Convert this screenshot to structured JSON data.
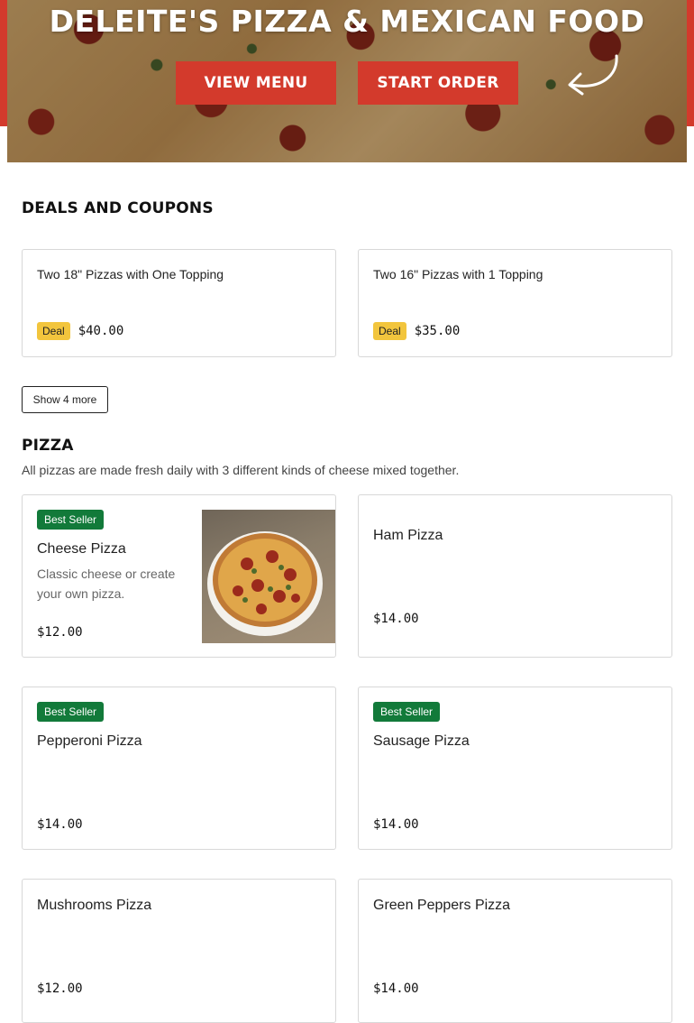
{
  "hero": {
    "title": "DELEITE'S PIZZA & MEXICAN FOOD",
    "view_menu_label": "VIEW MENU",
    "start_order_label": "START ORDER"
  },
  "deals": {
    "title": "DEALS AND COUPONS",
    "items": [
      {
        "name": "Two 18\" Pizzas with One Topping",
        "badge": "Deal",
        "price": "$40.00"
      },
      {
        "name": "Two 16\" Pizzas with 1 Topping",
        "badge": "Deal",
        "price": "$35.00"
      }
    ],
    "show_more_label": "Show 4 more"
  },
  "pizza": {
    "title": "PIZZA",
    "description": "All pizzas are made fresh daily with 3 different kinds of cheese mixed together.",
    "items": [
      {
        "name": "Cheese Pizza",
        "badge": "Best Seller",
        "description": "Classic cheese or create your own pizza.",
        "price": "$12.00"
      },
      {
        "name": "Ham Pizza",
        "price": "$14.00"
      },
      {
        "name": "Pepperoni Pizza",
        "badge": "Best Seller",
        "price": "$14.00"
      },
      {
        "name": "Sausage Pizza",
        "badge": "Best Seller",
        "price": "$14.00"
      },
      {
        "name": "Mushrooms Pizza",
        "price": "$12.00"
      },
      {
        "name": "Green Peppers Pizza",
        "price": "$14.00"
      }
    ]
  },
  "colors": {
    "brand_red": "#d33a2c",
    "deal_yellow": "#f2c53d",
    "best_seller_green": "#127a3a"
  },
  "icons": {
    "hero_arrow": "curved-arrow-icon"
  }
}
